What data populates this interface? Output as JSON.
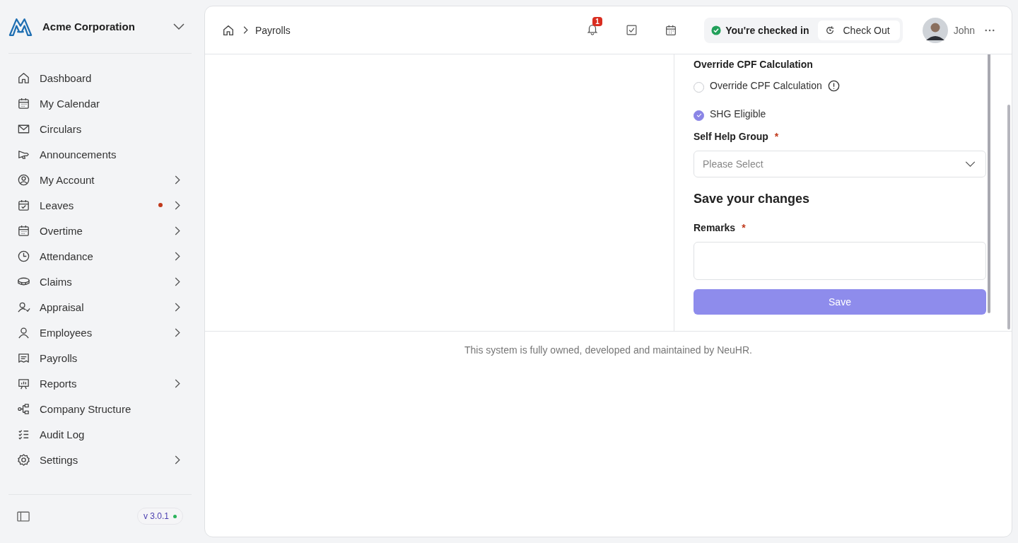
{
  "company": {
    "name": "Acme Corporation"
  },
  "sidebar": {
    "items": [
      {
        "label": "Dashboard",
        "has_submenu": false,
        "notification": false
      },
      {
        "label": "My Calendar",
        "has_submenu": false,
        "notification": false
      },
      {
        "label": "Circulars",
        "has_submenu": false,
        "notification": false
      },
      {
        "label": "Announcements",
        "has_submenu": false,
        "notification": false
      },
      {
        "label": "My Account",
        "has_submenu": true,
        "notification": false
      },
      {
        "label": "Leaves",
        "has_submenu": true,
        "notification": true
      },
      {
        "label": "Overtime",
        "has_submenu": true,
        "notification": false
      },
      {
        "label": "Attendance",
        "has_submenu": true,
        "notification": false
      },
      {
        "label": "Claims",
        "has_submenu": true,
        "notification": false
      },
      {
        "label": "Appraisal",
        "has_submenu": true,
        "notification": false
      },
      {
        "label": "Employees",
        "has_submenu": true,
        "notification": false
      },
      {
        "label": "Payrolls",
        "has_submenu": false,
        "notification": false
      },
      {
        "label": "Reports",
        "has_submenu": true,
        "notification": false
      },
      {
        "label": "Company Structure",
        "has_submenu": false,
        "notification": false
      },
      {
        "label": "Audit Log",
        "has_submenu": false,
        "notification": false
      },
      {
        "label": "Settings",
        "has_submenu": true,
        "notification": false
      }
    ],
    "version": "v 3.0.1"
  },
  "header": {
    "breadcrumb": "Payrolls",
    "notification_count": "1",
    "check_status": "You're checked in",
    "check_button": "Check Out",
    "user": "John"
  },
  "form": {
    "section_label": "Override CPF Calculation",
    "checkboxes": [
      {
        "label": "Override CPF Calculation",
        "checked": false,
        "info": true
      },
      {
        "label": "SHG Eligible",
        "checked": true,
        "info": false
      }
    ],
    "select": {
      "label": "Self Help Group",
      "required_mark": "*",
      "placeholder": "Please Select"
    },
    "heading": "Save your changes",
    "remarks": {
      "label": "Remarks",
      "required_mark": "*"
    },
    "save_button": "Save"
  },
  "footer": "This system is fully owned, developed and maintained by NeuHR."
}
